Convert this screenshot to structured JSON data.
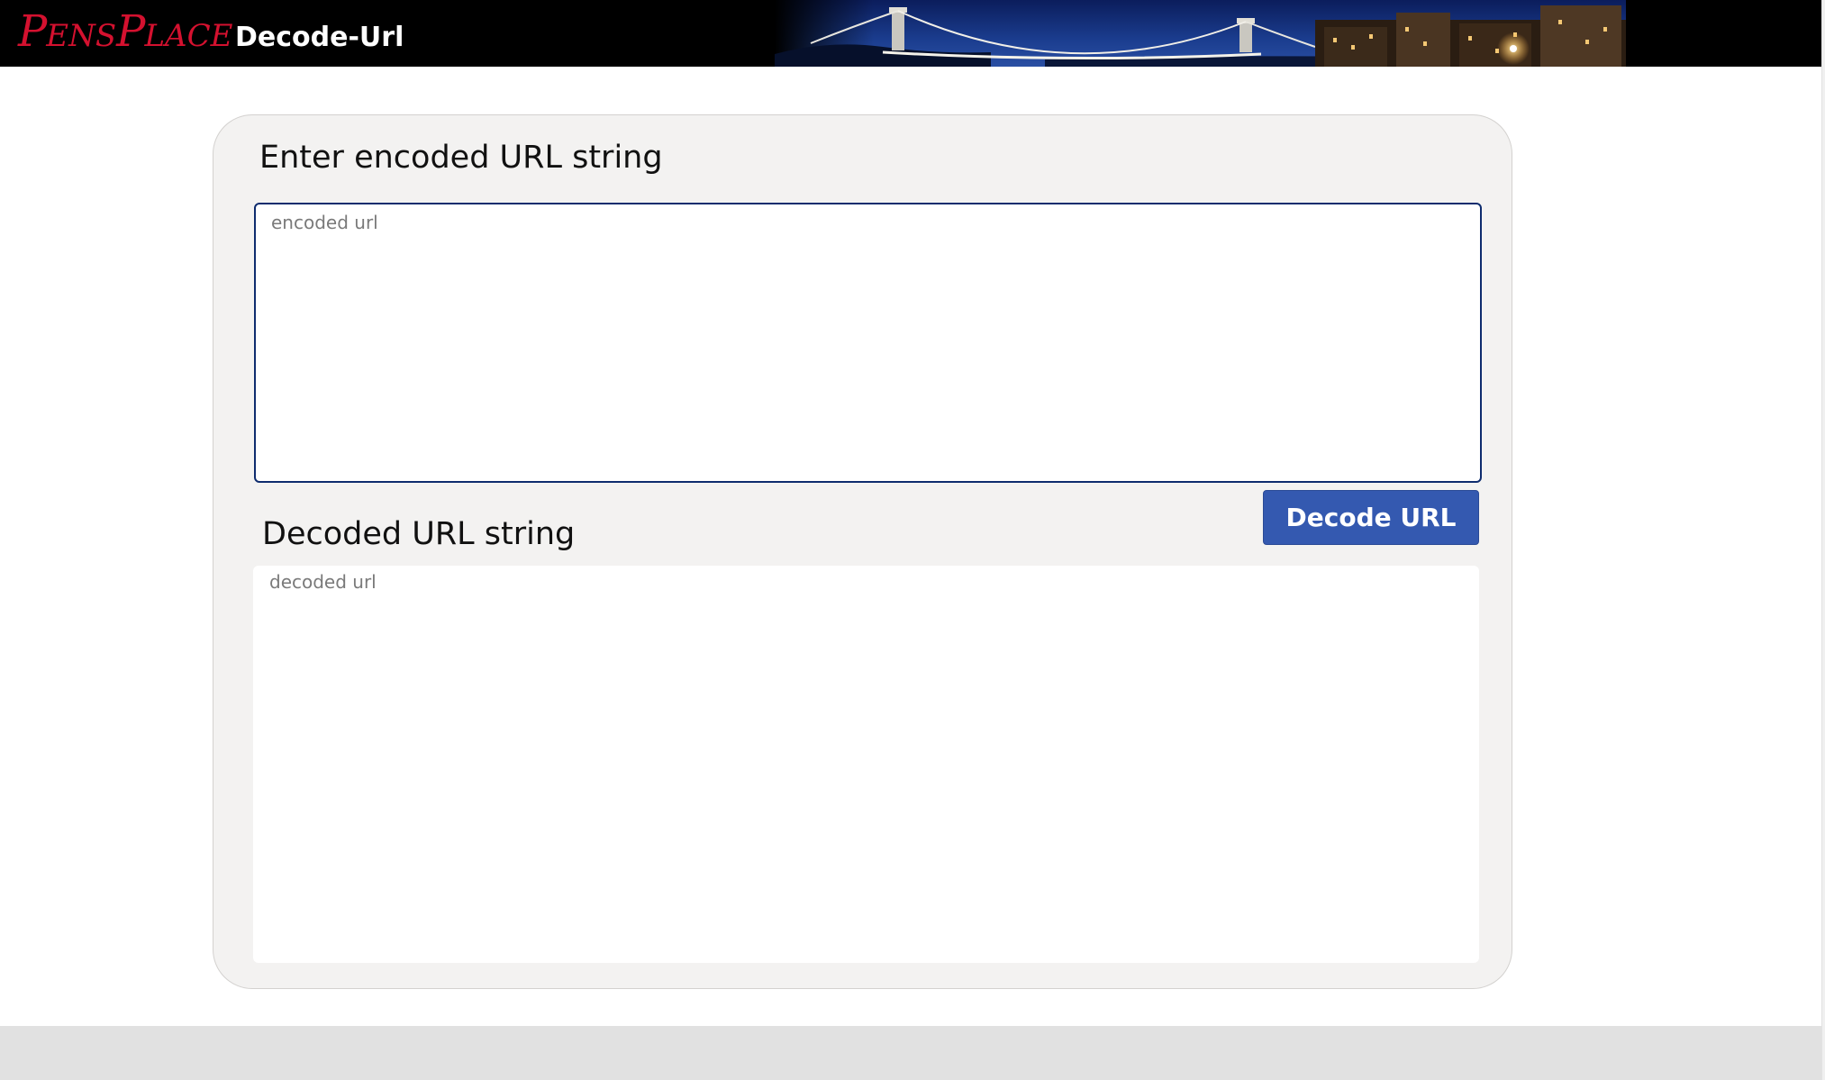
{
  "header": {
    "brand_first": "P",
    "brand_first_rest": "ENS",
    "brand_second": "P",
    "brand_second_rest": "LACE",
    "app_title": "Decode-Url"
  },
  "encoder": {
    "heading": "Enter encoded URL string",
    "value": "",
    "placeholder": "encoded url"
  },
  "decode_button": {
    "label": "Decode URL"
  },
  "decoder": {
    "heading": "Decoded URL string",
    "value": "",
    "placeholder": "decoded url"
  },
  "colors": {
    "header_bg": "#000000",
    "brand_red": "#d4112f",
    "panel_bg": "#f3f2f1",
    "button_blue": "#3459b0",
    "input_border": "#0e2c6e",
    "footer_bg": "#e1e1e1"
  },
  "icons": {
    "banner": "suspension-bridge-night-photo"
  }
}
